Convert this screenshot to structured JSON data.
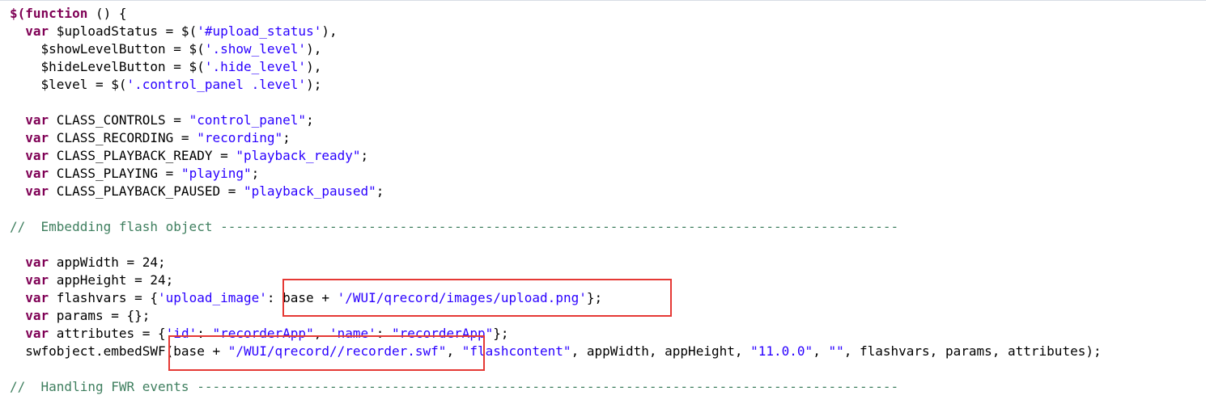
{
  "colors": {
    "keyword": "#7f0055",
    "string": "#2a00ff",
    "comment": "#3f7f5f",
    "text": "#000000",
    "highlight_box": "#e53935"
  },
  "lines": [
    [
      {
        "t": "kw",
        "v": "$("
      },
      {
        "t": "kw",
        "v": "function"
      },
      {
        "t": "plain",
        "v": " () {"
      }
    ],
    [
      {
        "t": "plain",
        "v": "  "
      },
      {
        "t": "kw",
        "v": "var"
      },
      {
        "t": "plain",
        "v": " $uploadStatus = $("
      },
      {
        "t": "str",
        "v": "'#upload_status'"
      },
      {
        "t": "plain",
        "v": "),"
      }
    ],
    [
      {
        "t": "plain",
        "v": "    $showLevelButton = $("
      },
      {
        "t": "str",
        "v": "'.show_level'"
      },
      {
        "t": "plain",
        "v": "),"
      }
    ],
    [
      {
        "t": "plain",
        "v": "    $hideLevelButton = $("
      },
      {
        "t": "str",
        "v": "'.hide_level'"
      },
      {
        "t": "plain",
        "v": "),"
      }
    ],
    [
      {
        "t": "plain",
        "v": "    $level = $("
      },
      {
        "t": "str",
        "v": "'.control_panel .level'"
      },
      {
        "t": "plain",
        "v": ");"
      }
    ],
    [],
    [
      {
        "t": "plain",
        "v": "  "
      },
      {
        "t": "kw",
        "v": "var"
      },
      {
        "t": "plain",
        "v": " CLASS_CONTROLS = "
      },
      {
        "t": "str",
        "v": "\"control_panel\""
      },
      {
        "t": "plain",
        "v": ";"
      }
    ],
    [
      {
        "t": "plain",
        "v": "  "
      },
      {
        "t": "kw",
        "v": "var"
      },
      {
        "t": "plain",
        "v": " CLASS_RECORDING = "
      },
      {
        "t": "str",
        "v": "\"recording\""
      },
      {
        "t": "plain",
        "v": ";"
      }
    ],
    [
      {
        "t": "plain",
        "v": "  "
      },
      {
        "t": "kw",
        "v": "var"
      },
      {
        "t": "plain",
        "v": " CLASS_PLAYBACK_READY = "
      },
      {
        "t": "str",
        "v": "\"playback_ready\""
      },
      {
        "t": "plain",
        "v": ";"
      }
    ],
    [
      {
        "t": "plain",
        "v": "  "
      },
      {
        "t": "kw",
        "v": "var"
      },
      {
        "t": "plain",
        "v": " CLASS_PLAYING = "
      },
      {
        "t": "str",
        "v": "\"playing\""
      },
      {
        "t": "plain",
        "v": ";"
      }
    ],
    [
      {
        "t": "plain",
        "v": "  "
      },
      {
        "t": "kw",
        "v": "var"
      },
      {
        "t": "plain",
        "v": " CLASS_PLAYBACK_PAUSED = "
      },
      {
        "t": "str",
        "v": "\"playback_paused\""
      },
      {
        "t": "plain",
        "v": ";"
      }
    ],
    [],
    [
      {
        "t": "cmt",
        "v": "//  Embedding flash object ---------------------------------------------------------------------------------------"
      }
    ],
    [],
    [
      {
        "t": "plain",
        "v": "  "
      },
      {
        "t": "kw",
        "v": "var"
      },
      {
        "t": "plain",
        "v": " appWidth = 24;"
      }
    ],
    [
      {
        "t": "plain",
        "v": "  "
      },
      {
        "t": "kw",
        "v": "var"
      },
      {
        "t": "plain",
        "v": " appHeight = 24;"
      }
    ],
    [
      {
        "t": "plain",
        "v": "  "
      },
      {
        "t": "kw",
        "v": "var"
      },
      {
        "t": "plain",
        "v": " flashvars = {"
      },
      {
        "t": "str",
        "v": "'upload_image'"
      },
      {
        "t": "plain",
        "v": ": base + "
      },
      {
        "t": "str",
        "v": "'/WUI/qrecord/images/upload.png'"
      },
      {
        "t": "plain",
        "v": "};"
      }
    ],
    [
      {
        "t": "plain",
        "v": "  "
      },
      {
        "t": "kw",
        "v": "var"
      },
      {
        "t": "plain",
        "v": " params = {};"
      }
    ],
    [
      {
        "t": "plain",
        "v": "  "
      },
      {
        "t": "kw",
        "v": "var"
      },
      {
        "t": "plain",
        "v": " attributes = {"
      },
      {
        "t": "str",
        "v": "'id'"
      },
      {
        "t": "plain",
        "v": ": "
      },
      {
        "t": "str",
        "v": "\"recorderApp\""
      },
      {
        "t": "plain",
        "v": ", "
      },
      {
        "t": "str",
        "v": "'name'"
      },
      {
        "t": "plain",
        "v": ": "
      },
      {
        "t": "str",
        "v": "\"recorderApp\""
      },
      {
        "t": "plain",
        "v": "};"
      }
    ],
    [
      {
        "t": "plain",
        "v": "  swfobject.embedSWF(base + "
      },
      {
        "t": "str",
        "v": "\"/WUI/qrecord//recorder.swf\""
      },
      {
        "t": "plain",
        "v": ", "
      },
      {
        "t": "str",
        "v": "\"flashcontent\""
      },
      {
        "t": "plain",
        "v": ", appWidth, appHeight, "
      },
      {
        "t": "str",
        "v": "\"11.0.0\""
      },
      {
        "t": "plain",
        "v": ", "
      },
      {
        "t": "str",
        "v": "\"\""
      },
      {
        "t": "plain",
        "v": ", flashvars, params, attributes);"
      }
    ],
    [],
    [
      {
        "t": "cmt",
        "v": "//  Handling FWR events ------------------------------------------------------------------------------------------"
      }
    ]
  ]
}
